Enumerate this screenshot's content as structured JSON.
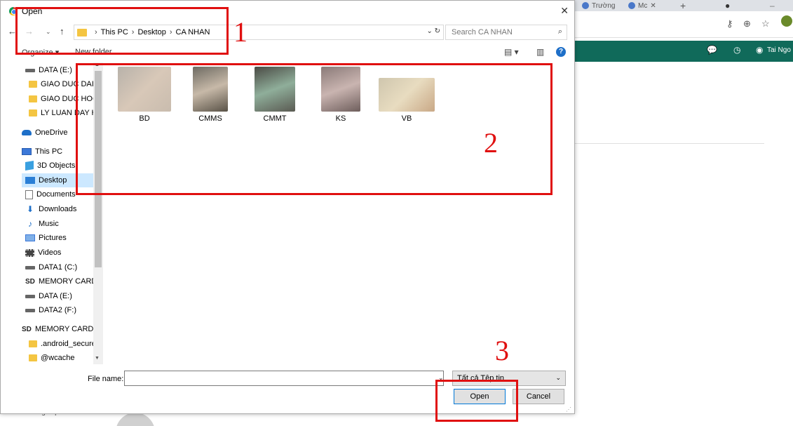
{
  "browser": {
    "tabs": [
      "Trường",
      "Mc"
    ],
    "user_name": "Tai Ngo",
    "bottom_text": "trung cap"
  },
  "dialog": {
    "title": "Open",
    "address": [
      "This PC",
      "Desktop",
      "CA NHAN"
    ],
    "search_placeholder": "Search CA NHAN",
    "organize_label": "Organize ▾",
    "new_folder_label": "New folder",
    "sidebar": [
      {
        "label": "DATA (E:)",
        "icon": "drive-icon"
      },
      {
        "label": "GIAO DUC DAI H",
        "icon": "folder-icon"
      },
      {
        "label": "GIAO DUC HOC",
        "icon": "folder-icon"
      },
      {
        "label": "LY LUAN DAY HO",
        "icon": "folder-icon"
      },
      {
        "label": "OneDrive",
        "icon": "cloud-icon"
      },
      {
        "label": "This PC",
        "icon": "pc-icon"
      },
      {
        "label": "3D Objects",
        "icon": "cube-icon"
      },
      {
        "label": "Desktop",
        "icon": "desktop-icon"
      },
      {
        "label": "Documents",
        "icon": "document-icon"
      },
      {
        "label": "Downloads",
        "icon": "download-icon"
      },
      {
        "label": "Music",
        "icon": "music-icon"
      },
      {
        "label": "Pictures",
        "icon": "pictures-icon"
      },
      {
        "label": "Videos",
        "icon": "videos-icon"
      },
      {
        "label": "DATA1 (C:)",
        "icon": "drive-icon"
      },
      {
        "label": "MEMORY CARD",
        "icon": "sd-card-icon"
      },
      {
        "label": "DATA (E:)",
        "icon": "drive-icon"
      },
      {
        "label": "DATA2 (F:)",
        "icon": "drive-icon"
      },
      {
        "label": "MEMORY CARD (I",
        "icon": "sd-card-icon"
      },
      {
        "label": ".android_secure",
        "icon": "folder-icon"
      },
      {
        "label": "@wcache",
        "icon": "folder-icon"
      }
    ],
    "files": [
      "BD",
      "CMMS",
      "CMMT",
      "KS",
      "VB"
    ],
    "file_name_label": "File name:",
    "file_name_value": "",
    "filter_value": "Tất cả Tệp tin",
    "open_label": "Open",
    "cancel_label": "Cancel"
  },
  "annotations": [
    "1",
    "2",
    "3"
  ],
  "colors": {
    "annotation": "#e01010",
    "browser_bar": "#106a5a",
    "selected": "#cce8ff"
  }
}
